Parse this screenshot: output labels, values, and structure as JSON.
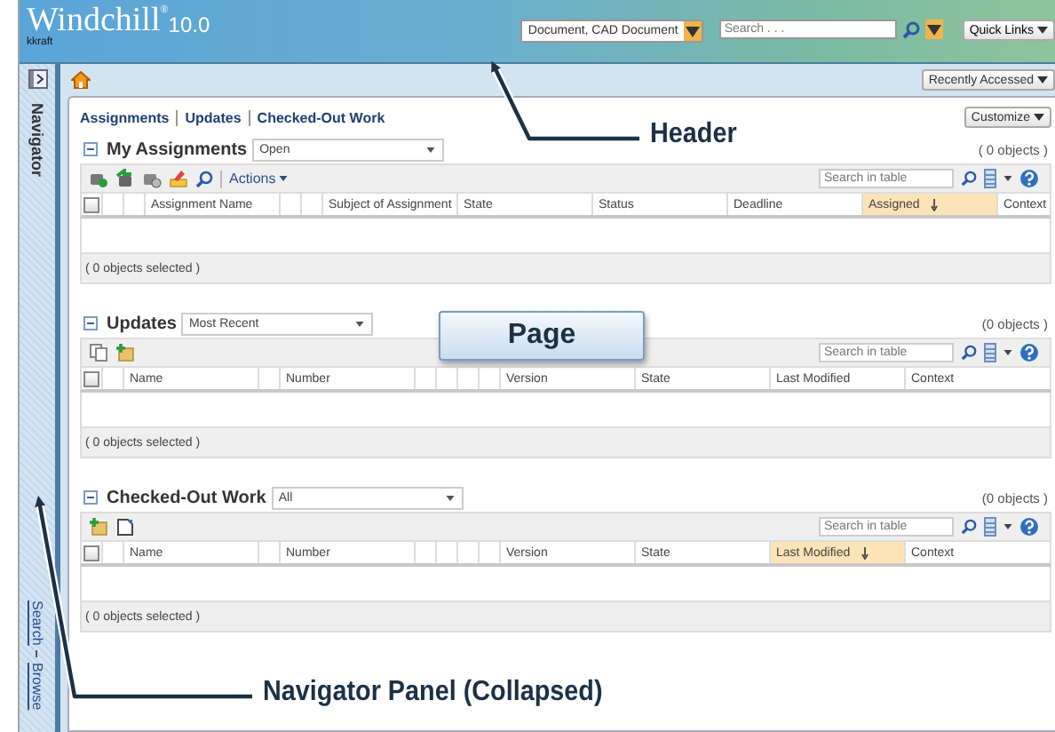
{
  "header": {
    "logo": "Windchill",
    "logo_mark": "®",
    "version": "10.0",
    "user": "kkraft",
    "search_type": "Document, CAD Document",
    "search": {
      "placeholder": "Search . . ."
    },
    "quick_links": "Quick Links"
  },
  "navigator": {
    "title": "Navigator",
    "links": [
      "Search",
      "Browse"
    ]
  },
  "toolbar": {
    "recently_accessed": "Recently Accessed"
  },
  "page": {
    "links": [
      "Assignments",
      "Updates",
      "Checked-Out Work"
    ],
    "customize": "Customize",
    "sections": [
      {
        "title": "My Assignments",
        "filter": "Open",
        "count": "( 0 objects )",
        "tools": [
          {
            "kind": "complete"
          },
          {
            "kind": "reassign"
          },
          {
            "kind": "remove"
          },
          {
            "kind": "edit"
          },
          {
            "kind": "find"
          }
        ],
        "actions": "Actions",
        "search": {
          "placeholder": "Search in table"
        },
        "columns": [
          {
            "kind": "check",
            "checked": false
          },
          {
            "kind": "blank"
          },
          {
            "kind": "blank"
          },
          {
            "kind": "text",
            "label": "Assignment Name",
            "sorted": false
          },
          {
            "kind": "blank"
          },
          {
            "kind": "blank"
          },
          {
            "kind": "text",
            "label": "Subject of Assignment",
            "sorted": false
          },
          {
            "kind": "text",
            "label": "State",
            "sorted": false
          },
          {
            "kind": "text",
            "label": "Status",
            "sorted": false
          },
          {
            "kind": "text",
            "label": "Deadline",
            "sorted": false
          },
          {
            "kind": "text",
            "label": "Assigned",
            "sorted": true
          },
          {
            "kind": "text",
            "label": "Context",
            "sorted": false
          }
        ],
        "footer": "( 0 objects selected )"
      },
      {
        "title": "Updates",
        "filter": "Most Recent",
        "count": "(0 objects )",
        "tools": [
          {
            "kind": "copy"
          },
          {
            "kind": "add"
          }
        ],
        "search": {
          "placeholder": "Search in table"
        },
        "columns": [
          {
            "kind": "check",
            "checked": false
          },
          {
            "kind": "blank"
          },
          {
            "kind": "text",
            "label": "Name",
            "sorted": false
          },
          {
            "kind": "blank"
          },
          {
            "kind": "text",
            "label": "Number",
            "sorted": false
          },
          {
            "kind": "blank"
          },
          {
            "kind": "blank"
          },
          {
            "kind": "blank"
          },
          {
            "kind": "blank"
          },
          {
            "kind": "text",
            "label": "Version",
            "sorted": false
          },
          {
            "kind": "text",
            "label": "State",
            "sorted": false
          },
          {
            "kind": "text",
            "label": "Last Modified",
            "sorted": false
          },
          {
            "kind": "text",
            "label": "Context",
            "sorted": false
          }
        ],
        "footer": "( 0 objects selected )"
      },
      {
        "title": "Checked-Out Work",
        "filter": "All",
        "count": "(0 objects )",
        "tools": [
          {
            "kind": "add"
          },
          {
            "kind": "new"
          }
        ],
        "search": {
          "placeholder": "Search in table"
        },
        "columns": [
          {
            "kind": "check",
            "checked": false
          },
          {
            "kind": "blank"
          },
          {
            "kind": "text",
            "label": "Name",
            "sorted": false
          },
          {
            "kind": "blank"
          },
          {
            "kind": "text",
            "label": "Number",
            "sorted": false
          },
          {
            "kind": "blank"
          },
          {
            "kind": "blank"
          },
          {
            "kind": "blank"
          },
          {
            "kind": "blank"
          },
          {
            "kind": "text",
            "label": "Version",
            "sorted": false
          },
          {
            "kind": "text",
            "label": "State",
            "sorted": false
          },
          {
            "kind": "text",
            "label": "Last Modified",
            "sorted": true
          },
          {
            "kind": "text",
            "label": "Context",
            "sorted": false
          }
        ],
        "footer": "( 0 objects selected )"
      }
    ]
  },
  "annotations": [
    {
      "kind": "callout",
      "text": "Header"
    },
    {
      "kind": "box",
      "text": "Page"
    },
    {
      "kind": "callout",
      "text": "Navigator Panel (Collapsed)"
    }
  ]
}
